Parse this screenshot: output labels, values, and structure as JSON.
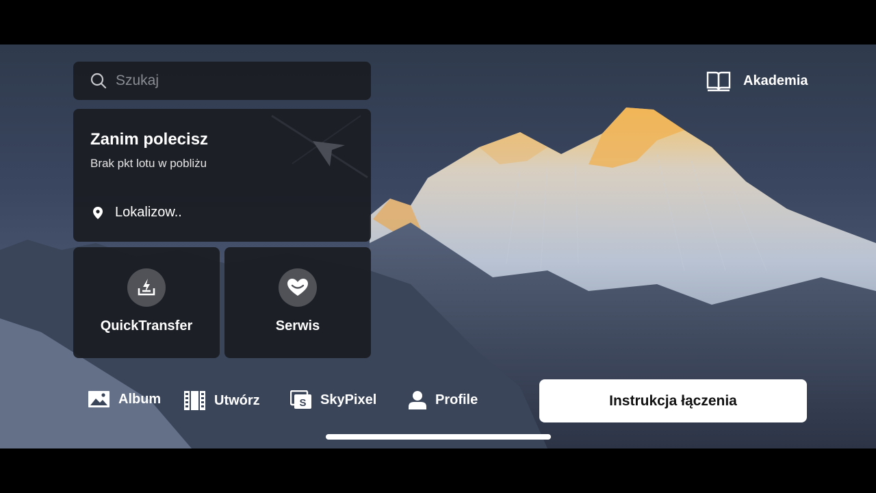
{
  "search": {
    "placeholder": "Szukaj"
  },
  "flight_card": {
    "title": "Zanim polecisz",
    "subtitle": "Brak pkt lotu w pobliżu",
    "location": "Lokalizow.."
  },
  "tiles": [
    {
      "label": "QuickTransfer",
      "icon": "quicktransfer-icon"
    },
    {
      "label": "Serwis",
      "icon": "service-heart-icon"
    }
  ],
  "academy": {
    "label": "Akademia",
    "icon": "book-icon"
  },
  "bottom_nav": [
    {
      "label": "Album",
      "icon": "image-icon"
    },
    {
      "label": "Utwórz",
      "icon": "film-strip-icon"
    },
    {
      "label": "SkyPixel",
      "icon": "skypixel-icon"
    },
    {
      "label": "Profile",
      "icon": "person-icon"
    }
  ],
  "connect_button": {
    "label": "Instrukcja łączenia"
  },
  "colors": {
    "card_bg": "#1a1c22",
    "button_bg": "#ffffff",
    "peak_glow": "#f0b050"
  }
}
